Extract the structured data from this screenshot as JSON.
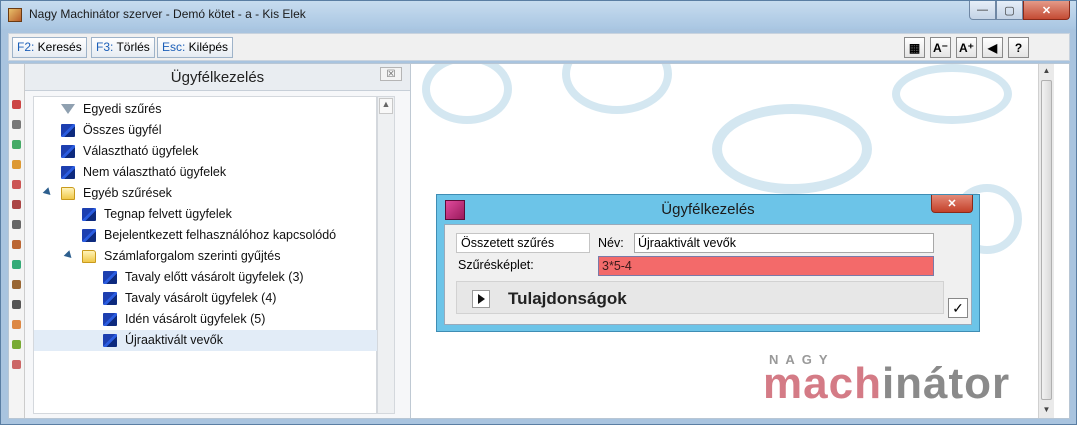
{
  "window": {
    "title": "Nagy Machinátor szerver - Demó kötet - a - Kis Elek",
    "minimize_label": "—",
    "maximize_label": "▢",
    "close_label": "✕"
  },
  "toolbar": {
    "search": {
      "key": "F2:",
      "label": " Keresés"
    },
    "delete": {
      "key": "F3:",
      "label": " Törlés"
    },
    "exit": {
      "key": "Esc:",
      "label": " Kilépés"
    },
    "icons": [
      {
        "name": "grid-icon",
        "glyph": "▦"
      },
      {
        "name": "font-decrease-icon",
        "glyph": "A⁻"
      },
      {
        "name": "font-increase-icon",
        "glyph": "A⁺"
      },
      {
        "name": "back-arrow-icon",
        "glyph": "◀"
      },
      {
        "name": "help-icon",
        "glyph": "?"
      }
    ]
  },
  "panel": {
    "title": "Ügyfélkezelés",
    "close_label": "☒",
    "tree": [
      {
        "label": "Egyedi szűrés",
        "icon": "funnel-icon",
        "level": 0
      },
      {
        "label": "Összes ügyfél",
        "icon": "user-icon",
        "level": 0
      },
      {
        "label": "Választható ügyfelek",
        "icon": "user-icon",
        "level": 0
      },
      {
        "label": "Nem választható ügyfelek",
        "icon": "user-icon",
        "level": 0
      },
      {
        "label": "Egyéb szűrések",
        "icon": "folder-icon",
        "level": 0,
        "expanded": true
      },
      {
        "label": "Tegnap felvett ügyfelek",
        "icon": "user-icon",
        "level": 1
      },
      {
        "label": "Bejelentkezett felhasználóhoz kapcsolódó",
        "icon": "user-icon",
        "level": 1
      },
      {
        "label": "Számlaforgalom szerinti gyűjtés",
        "icon": "folder-icon",
        "level": 1,
        "expanded": true
      },
      {
        "label": "Tavaly előtt vásárolt ügyfelek (3)",
        "icon": "user-icon",
        "level": 2
      },
      {
        "label": "Tavaly vásárolt ügyfelek (4)",
        "icon": "user-icon",
        "level": 2
      },
      {
        "label": "Idén vásárolt ügyfelek (5)",
        "icon": "user-icon",
        "level": 2
      },
      {
        "label": "Újraaktivált vevők",
        "icon": "user-icon",
        "level": 2,
        "selected": true
      }
    ]
  },
  "dialog": {
    "title": "Ügyfélkezelés",
    "close_label": "✕",
    "type_value": "Összetett szűrés",
    "name_label": "Név:",
    "name_value": "Újraaktivált vevők",
    "formula_label": "Szűrésképlet:",
    "formula_value": "3*5-4",
    "properties_label": "Tulajdonságok",
    "ok_label": "✓"
  },
  "logo": {
    "top": "NAGY",
    "part1": "mach",
    "part2": "inátor"
  },
  "colors": {
    "dialog_frame": "#6cc4e8",
    "formula_error_bg": "#f36a6a",
    "logo_accent": "#d47b86"
  }
}
